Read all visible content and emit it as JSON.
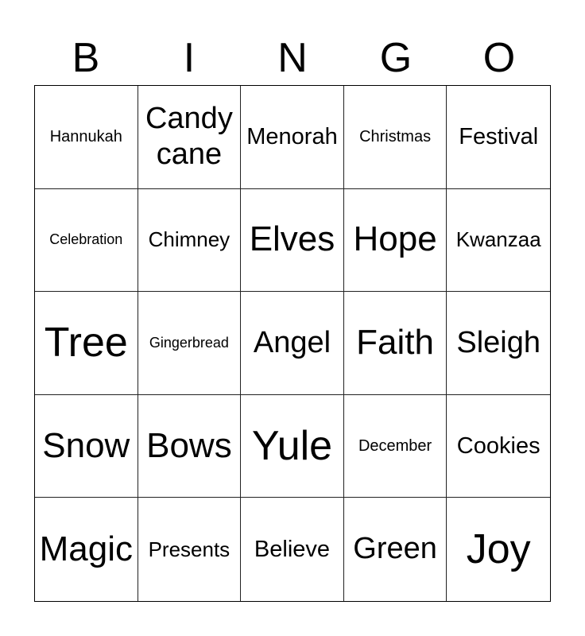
{
  "header": {
    "letters": [
      "B",
      "I",
      "N",
      "G",
      "O"
    ]
  },
  "grid": {
    "rows": [
      [
        "Hannukah",
        "Candy cane",
        "Menorah",
        "Christmas",
        "Festival"
      ],
      [
        "Celebration",
        "Chimney",
        "Elves",
        "Hope",
        "Kwanzaa"
      ],
      [
        "Tree",
        "Gingerbread",
        "Angel",
        "Faith",
        "Sleigh"
      ],
      [
        "Snow",
        "Bows",
        "Yule",
        "December",
        "Cookies"
      ],
      [
        "Magic",
        "Presents",
        "Believe",
        "Green",
        "Joy"
      ]
    ]
  }
}
